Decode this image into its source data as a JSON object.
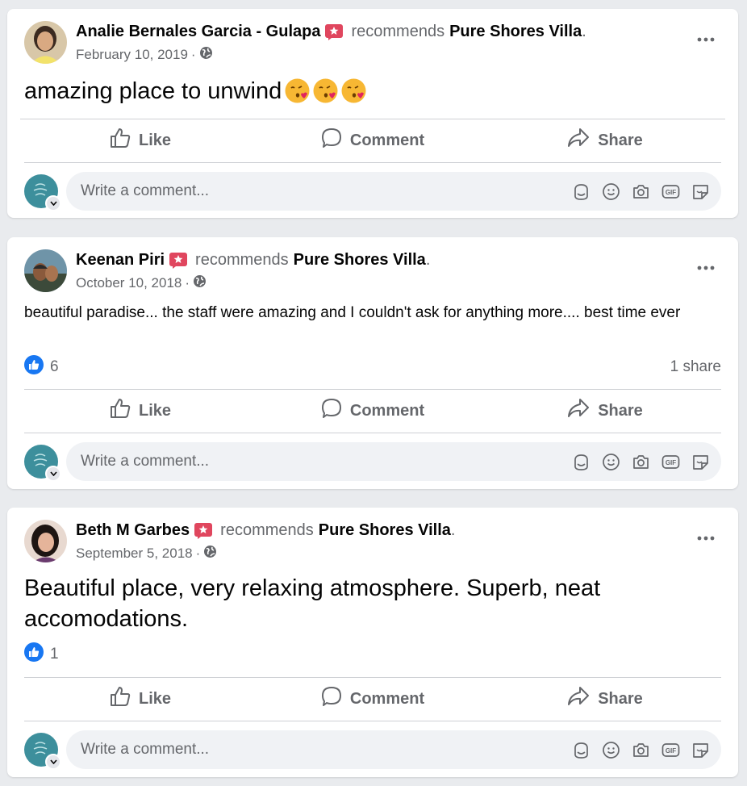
{
  "posts": [
    {
      "author": "Analie Bernales Garcia - Gulapa",
      "recommends": "recommends",
      "page": "Pure Shores Villa",
      "date": "February 10, 2019",
      "text": "amazing place to unwind",
      "emoji_count": 3,
      "reactions": "",
      "shares": ""
    },
    {
      "author": "Keenan Piri",
      "recommends": "recommends",
      "page": "Pure Shores Villa",
      "date": "October 10, 2018",
      "text": "beautiful paradise... the staff were amazing and I couldn't ask for anything more.... best time ever",
      "reactions": "6",
      "shares": "1 share"
    },
    {
      "author": "Beth M Garbes",
      "recommends": "recommends",
      "page": "Pure Shores Villa",
      "date": "September 5, 2018",
      "text": "Beautiful place, very relaxing atmosphere. Superb, neat accomodations.",
      "reactions": "1",
      "shares": ""
    }
  ],
  "actions": {
    "like": "Like",
    "comment": "Comment",
    "share": "Share"
  },
  "comment_placeholder": "Write a comment...",
  "gif_label": "GIF",
  "separator": "·",
  "period": ".",
  "colors": {
    "like_blue": "#1877f2",
    "secondary_text": "#65676b",
    "recommend_red": "#e0465e"
  }
}
